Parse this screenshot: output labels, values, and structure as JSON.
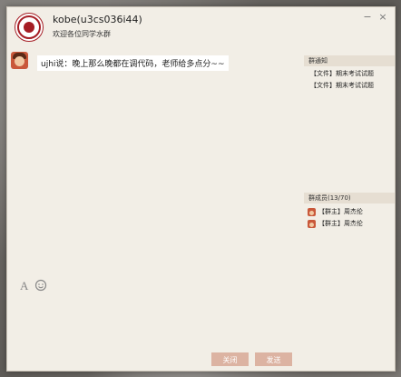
{
  "window": {
    "title": "kobe(u3cs036i44)",
    "subtitle": "欢迎各位同学水群",
    "minimize_glyph": "−",
    "close_glyph": "×"
  },
  "chat": {
    "messages": [
      {
        "text": "ujhi说：晚上那么晚都在调代码，老师给多点分~~"
      }
    ]
  },
  "toolbar": {
    "font_icon": "font-A-icon",
    "emoji_icon": "smiley-icon",
    "font_glyph": "A",
    "emoji_glyph": "☺"
  },
  "buttons": {
    "shutdown_label": "关闭",
    "send_label": "发送"
  },
  "sidebar": {
    "notice_header": "群通知",
    "notices": [
      {
        "label": "【文件】期末考试试题"
      },
      {
        "label": "【文件】期末考试试题"
      }
    ],
    "members_header": "群成员(13/70)",
    "members": [
      {
        "label": "【群主】周杰伦"
      },
      {
        "label": "【群主】周杰伦"
      }
    ]
  },
  "colors": {
    "window_bg": "#f2eee6",
    "accent_red": "#a51d24",
    "button_bg": "#dcb3a2",
    "side_header_bg": "#e6ded2"
  }
}
